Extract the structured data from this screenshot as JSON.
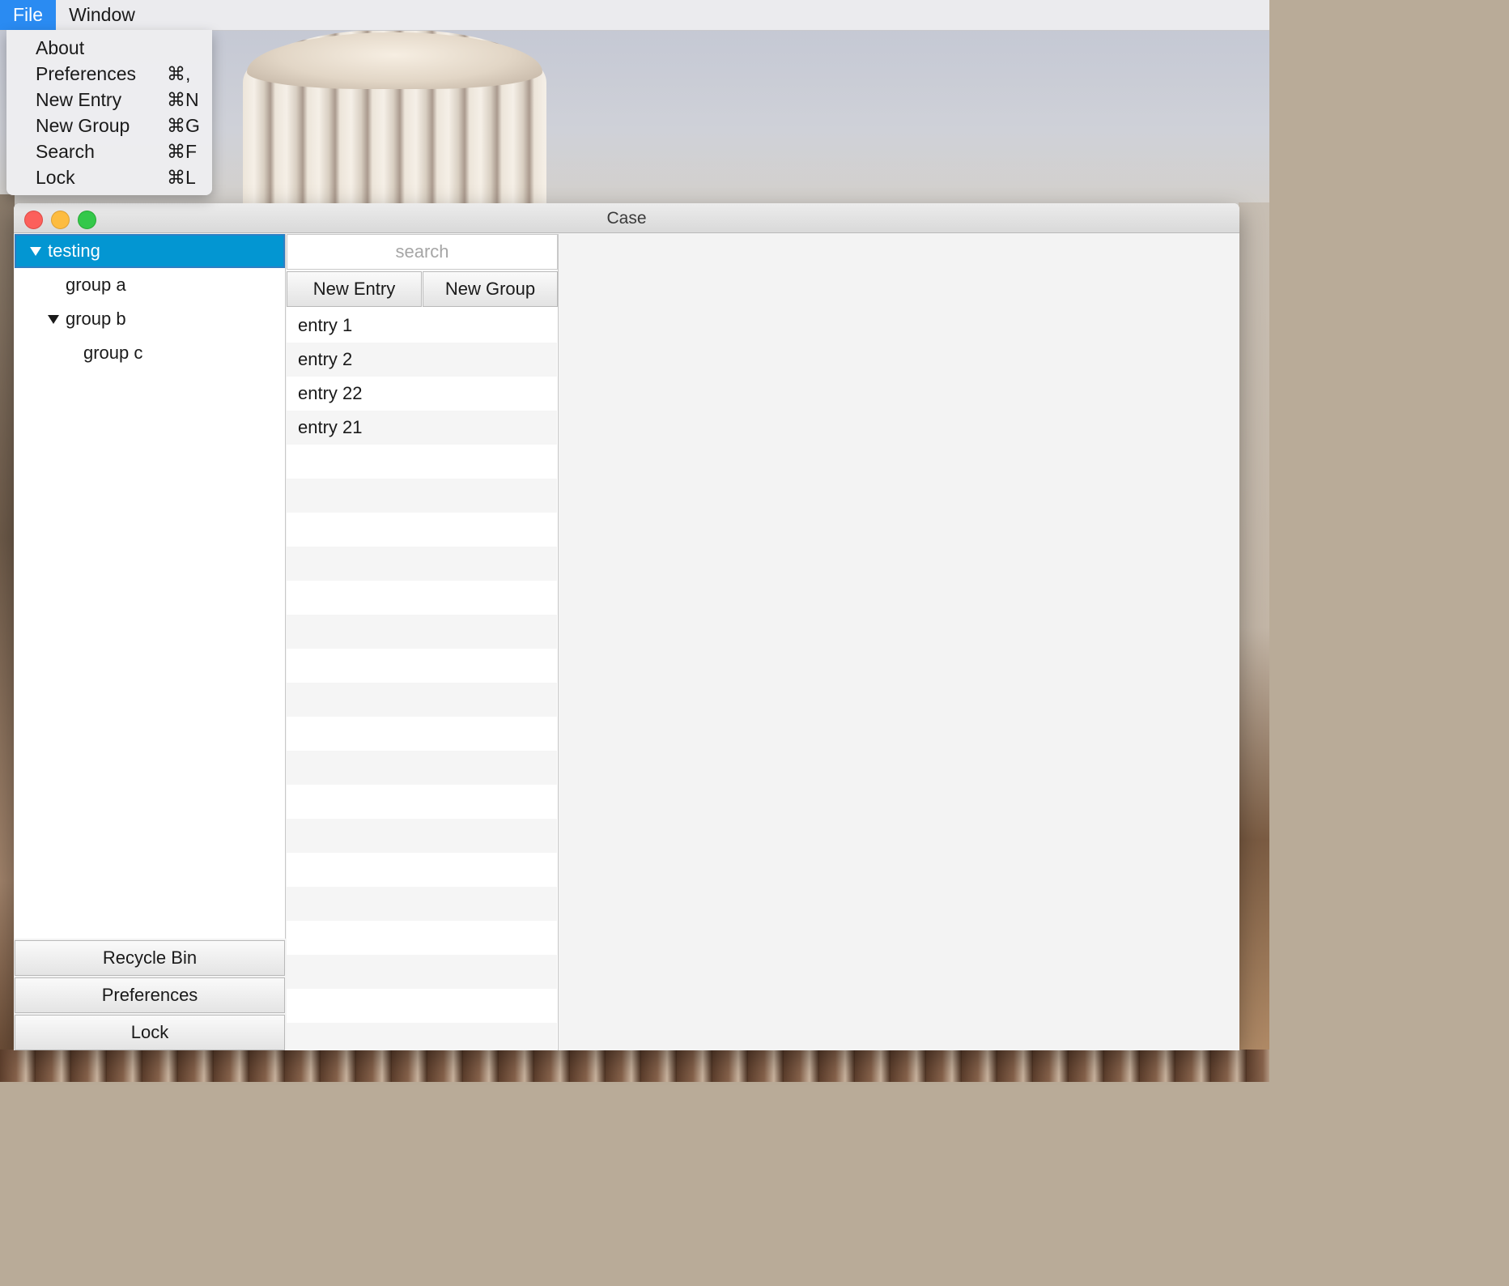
{
  "menubar": {
    "items": [
      {
        "label": "File"
      },
      {
        "label": "Window"
      }
    ]
  },
  "file_menu": {
    "items": [
      {
        "label": "About",
        "shortcut": ""
      },
      {
        "label": "Preferences",
        "shortcut": "⌘,"
      },
      {
        "label": "New Entry",
        "shortcut": "⌘N"
      },
      {
        "label": "New Group",
        "shortcut": "⌘G"
      },
      {
        "label": "Search",
        "shortcut": "⌘F"
      },
      {
        "label": "Lock",
        "shortcut": "⌘L"
      }
    ]
  },
  "window": {
    "title": "Case"
  },
  "tree": {
    "items": [
      {
        "label": "testing",
        "expanded": true,
        "selected": true
      },
      {
        "label": "group a"
      },
      {
        "label": "group b",
        "expanded": true
      },
      {
        "label": "group c"
      }
    ]
  },
  "sidebar_buttons": {
    "recycle_bin": "Recycle Bin",
    "preferences": "Preferences",
    "lock": "Lock"
  },
  "search": {
    "placeholder": "search",
    "value": ""
  },
  "actions": {
    "new_entry": "New Entry",
    "new_group": "New Group"
  },
  "entries": {
    "items": [
      {
        "label": "entry 1"
      },
      {
        "label": "entry 2"
      },
      {
        "label": "entry 22"
      },
      {
        "label": "entry 21"
      },
      {
        "label": ""
      },
      {
        "label": ""
      },
      {
        "label": ""
      },
      {
        "label": ""
      },
      {
        "label": ""
      },
      {
        "label": ""
      },
      {
        "label": ""
      },
      {
        "label": ""
      },
      {
        "label": ""
      },
      {
        "label": ""
      },
      {
        "label": ""
      },
      {
        "label": ""
      },
      {
        "label": ""
      },
      {
        "label": ""
      },
      {
        "label": ""
      },
      {
        "label": ""
      },
      {
        "label": ""
      },
      {
        "label": ""
      }
    ]
  },
  "colors": {
    "selection": "#0396d2",
    "menu_active": "#2a8bf2",
    "close": "#fc605b",
    "minimize": "#fdbc40",
    "maximize": "#34c84a"
  }
}
